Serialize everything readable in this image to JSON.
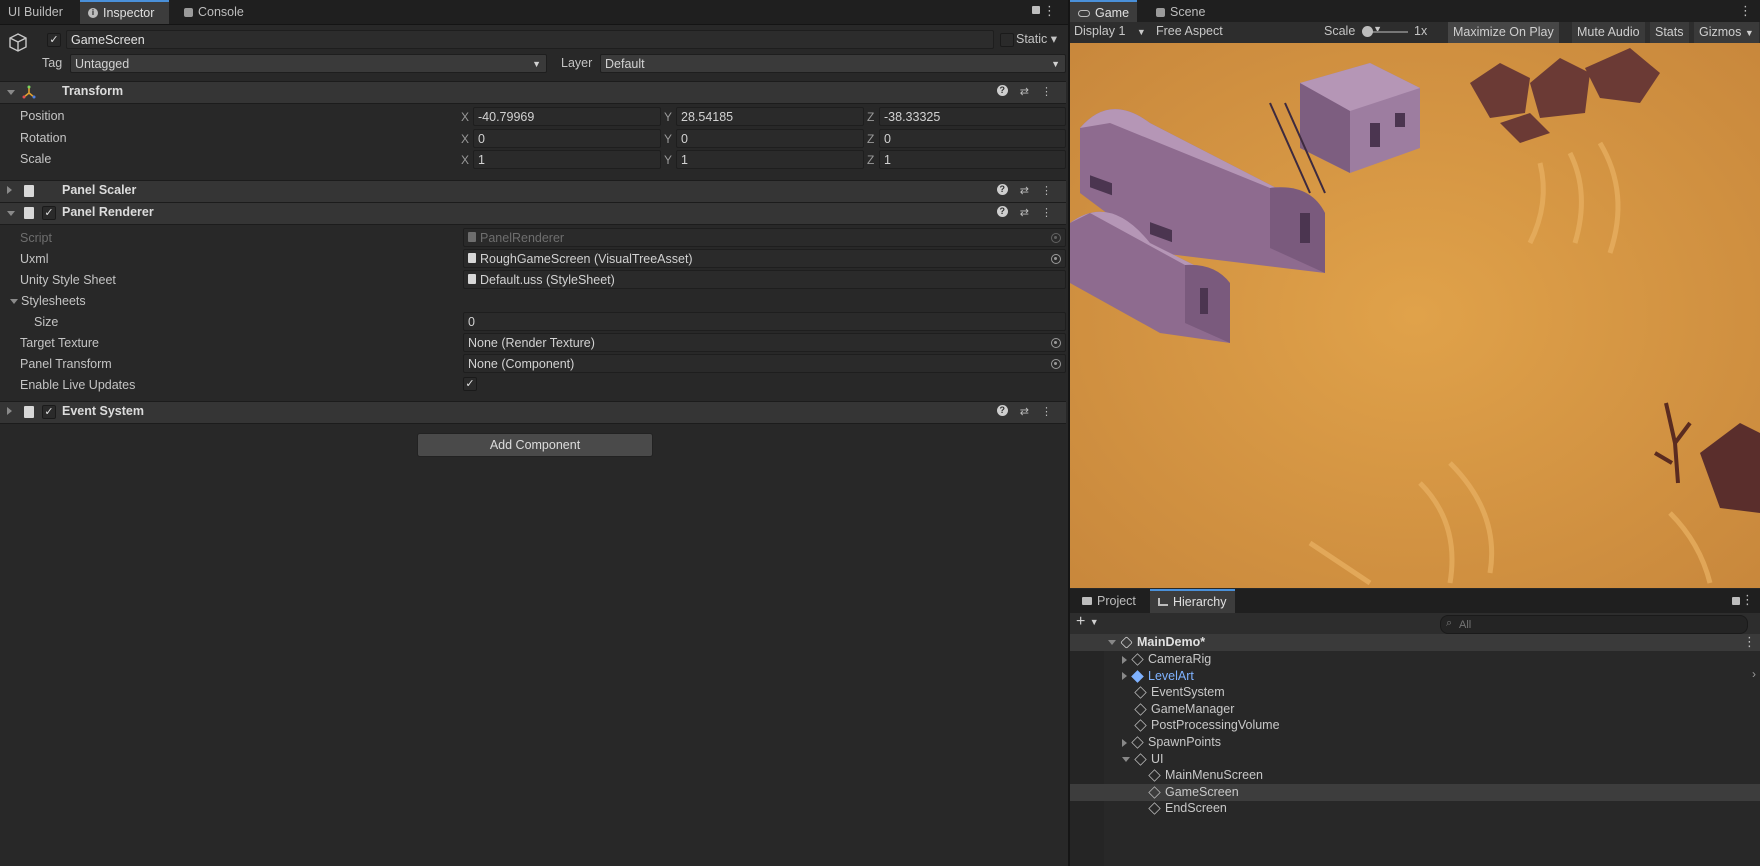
{
  "left_tabs": [
    "UI Builder",
    "Inspector",
    "Console"
  ],
  "inspector": {
    "object_name": "GameScreen",
    "static_label": "Static",
    "tag_label": "Tag",
    "tag_value": "Untagged",
    "layer_label": "Layer",
    "layer_value": "Default",
    "transform": {
      "title": "Transform",
      "rows": [
        {
          "label": "Position",
          "x": "-40.79969",
          "y": "28.54185",
          "z": "-38.33325"
        },
        {
          "label": "Rotation",
          "x": "0",
          "y": "0",
          "z": "0"
        },
        {
          "label": "Scale",
          "x": "1",
          "y": "1",
          "z": "1"
        }
      ]
    },
    "panel_scaler": {
      "title": "Panel Scaler"
    },
    "panel_renderer": {
      "title": "Panel Renderer",
      "script_label": "Script",
      "script_value": "PanelRenderer",
      "uxml_label": "Uxml",
      "uxml_value": "RoughGameScreen (VisualTreeAsset)",
      "uss_label": "Unity Style Sheet",
      "uss_value": "Default.uss (StyleSheet)",
      "stylesheets_label": "Stylesheets",
      "size_label": "Size",
      "size_value": "0",
      "target_texture_label": "Target Texture",
      "target_texture_value": "None (Render Texture)",
      "panel_transform_label": "Panel Transform",
      "panel_transform_value": "None (Component)",
      "live_updates_label": "Enable Live Updates",
      "live_updates_checked": true
    },
    "event_system": {
      "title": "Event System"
    },
    "add_component": "Add Component"
  },
  "game_view": {
    "tabs": [
      "Game",
      "Scene"
    ],
    "display": "Display 1",
    "aspect": "Free Aspect",
    "scale_label": "Scale",
    "scale_value": "1x",
    "buttons": [
      "Maximize On Play",
      "Mute Audio",
      "Stats",
      "Gizmos"
    ]
  },
  "hierarchy": {
    "tabs": [
      "Project",
      "Hierarchy"
    ],
    "search_placeholder": "All",
    "scene": "MainDemo*",
    "items": [
      {
        "name": "CameraRig",
        "depth": 1,
        "fold": "closed"
      },
      {
        "name": "LevelArt",
        "depth": 1,
        "fold": "closed",
        "prefab": true
      },
      {
        "name": "EventSystem",
        "depth": 1,
        "fold": "none"
      },
      {
        "name": "GameManager",
        "depth": 1,
        "fold": "none"
      },
      {
        "name": "PostProcessingVolume",
        "depth": 1,
        "fold": "none"
      },
      {
        "name": "SpawnPoints",
        "depth": 1,
        "fold": "closed"
      },
      {
        "name": "UI",
        "depth": 1,
        "fold": "open"
      },
      {
        "name": "MainMenuScreen",
        "depth": 2,
        "fold": "none"
      },
      {
        "name": "GameScreen",
        "depth": 2,
        "fold": "none",
        "selected": true
      },
      {
        "name": "EndScreen",
        "depth": 2,
        "fold": "none"
      }
    ]
  },
  "colors": {
    "accent": "#4a90d9",
    "prefab": "#7fb2ff",
    "sand": "#d4943e",
    "building": "#8e6b8f"
  }
}
